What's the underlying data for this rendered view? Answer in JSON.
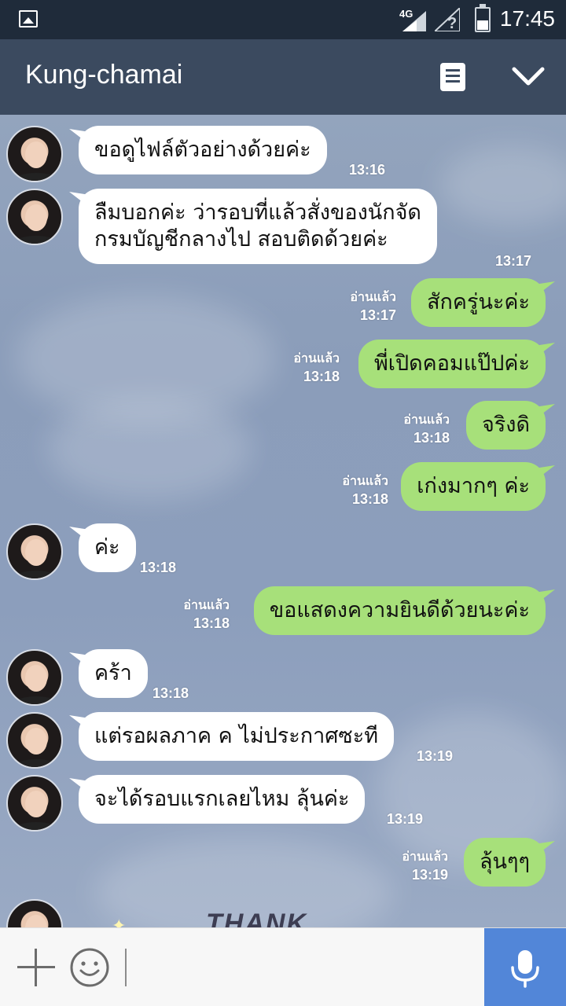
{
  "status_bar": {
    "network": "4G",
    "time": "17:45"
  },
  "header": {
    "title": "Kung-chamai"
  },
  "messages": [
    {
      "dir": "in",
      "text": "ขอดูไฟล์ตัวอย่างด้วยค่ะ",
      "time": "13:16"
    },
    {
      "dir": "in",
      "lines": [
        "ลืมบอกค่ะ ว่ารอบที่แล้วสั่งของนักจัด",
        "กรมบัญชีกลางไป สอบติดด้วยค่ะ"
      ],
      "time": "13:17"
    },
    {
      "dir": "out",
      "text": "สักครู่นะค่ะ",
      "read": "อ่านแล้ว",
      "time": "13:17"
    },
    {
      "dir": "out",
      "text": "พี่เปิดคอมแป๊ปค่ะ",
      "read": "อ่านแล้ว",
      "time": "13:18"
    },
    {
      "dir": "out",
      "text": "จริงดิ",
      "read": "อ่านแล้ว",
      "time": "13:18"
    },
    {
      "dir": "out",
      "text": "เก่งมากๆ ค่ะ",
      "read": "อ่านแล้ว",
      "time": "13:18"
    },
    {
      "dir": "in",
      "text": "ค่ะ",
      "time": "13:18"
    },
    {
      "dir": "out",
      "text": "ขอแสดงความยินดีด้วยนะค่ะ",
      "read": "อ่านแล้ว",
      "time": "13:18"
    },
    {
      "dir": "in",
      "text": "คร้า",
      "time": "13:18"
    },
    {
      "dir": "in",
      "text": "แต่รอผลภาค ค ไม่ประกาศซะที",
      "time": "13:19"
    },
    {
      "dir": "in",
      "text": "จะได้รอบแรกเลยไหม ลุ้นค่ะ",
      "time": "13:19"
    },
    {
      "dir": "out",
      "text": "ลุ้นๆๆ",
      "read": "อ่านแล้ว",
      "time": "13:19"
    }
  ],
  "sticker": {
    "text": "THANK"
  },
  "input": {
    "value": "",
    "placeholder": ""
  },
  "colors": {
    "header_bg": "#3b4a5f",
    "status_bg": "#1f2b3a",
    "incoming_bubble": "#ffffff",
    "outgoing_bubble": "#a7e07a",
    "mic_button": "#5286d8"
  },
  "icons": {
    "status": [
      "image-notification-icon",
      "signal-icon",
      "sim-icon",
      "battery-icon"
    ],
    "header": [
      "note-icon",
      "chevron-down-icon"
    ],
    "input": [
      "plus-icon",
      "emoji-icon",
      "mic-icon"
    ]
  }
}
